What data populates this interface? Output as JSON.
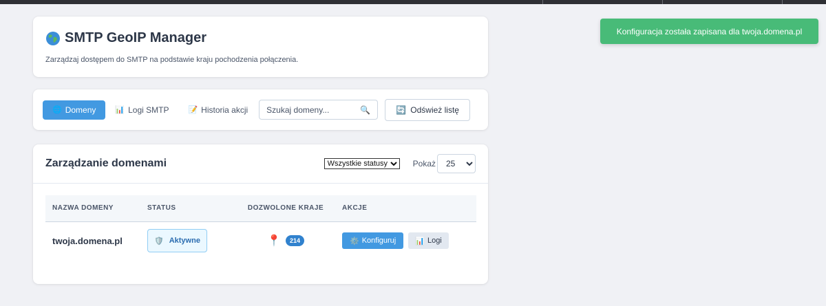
{
  "header": {
    "title": "SMTP GeoIP Manager",
    "subtitle": "Zarządzaj dostępem do SMTP na podstawie kraju pochodzenia połączenia."
  },
  "nav": {
    "tabs": [
      {
        "label": "Domeny",
        "icon": "globe-icon",
        "active": true
      },
      {
        "label": "Logi SMTP",
        "icon": "bar-chart-icon",
        "active": false
      },
      {
        "label": "Historia akcji",
        "icon": "memo-icon",
        "active": false
      }
    ],
    "search": {
      "placeholder": "Szukaj domeny...",
      "value": ""
    },
    "refresh_label": "Odśwież listę"
  },
  "domains": {
    "title": "Zarządzanie domenami",
    "status_filter": "Wszystkie statusy",
    "show_label": "Pokaż",
    "per_page": "25",
    "columns": [
      "NAZWA DOMENY",
      "STATUS",
      "DOZWOLONE KRAJE",
      "AKCJE"
    ],
    "rows": [
      {
        "domain": "twoja.domena.pl",
        "status": "Aktywne",
        "countries": "214",
        "configure_label": "Konfiguruj",
        "logs_label": "Logi"
      }
    ]
  },
  "toast": {
    "message": "Konfiguracja została zapisana dla twoja.domena.pl"
  },
  "colors": {
    "accent": "#4299e1",
    "success": "#48bb78",
    "background": "#f0f1f5"
  }
}
